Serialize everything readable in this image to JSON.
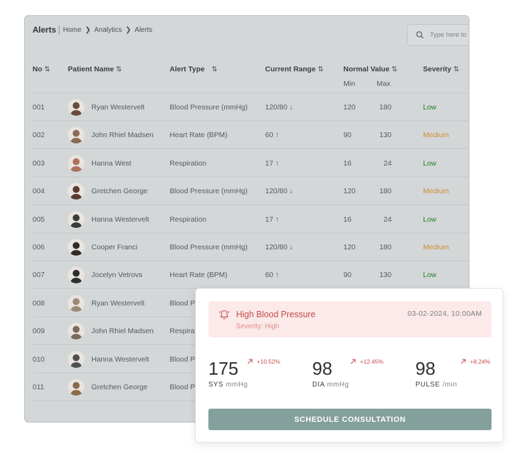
{
  "header": {
    "title": "Alerts",
    "breadcrumb": [
      "Home",
      "Analytics",
      "Alerts"
    ],
    "search_placeholder": "Type here to search"
  },
  "table": {
    "columns": {
      "no": "No",
      "patient": "Patient Name",
      "alert_type": "Alert Type",
      "current_range": "Current Range",
      "normal_value": "Normal Value",
      "normal_min": "Min",
      "normal_max": "Max",
      "severity": "Severity"
    },
    "rows": [
      {
        "no": "001",
        "name": "Ryan Westervelt",
        "type": "Blood Pressure (mmHg)",
        "range": "120/80 ↓",
        "min": "120",
        "max": "180",
        "severity": "Low",
        "sev_level": "low"
      },
      {
        "no": "002",
        "name": "John Rhiel Madsen",
        "type": "Heart Rate (BPM)",
        "range": "60 ↑",
        "min": "90",
        "max": "130",
        "severity": "Medium",
        "sev_level": "medium"
      },
      {
        "no": "003",
        "name": "Hanna West",
        "type": "Respiration",
        "range": "17 ↑",
        "min": "16",
        "max": "24",
        "severity": "Low",
        "sev_level": "low"
      },
      {
        "no": "004",
        "name": "Gretchen George",
        "type": "Blood Pressure (mmHg)",
        "range": "120/80 ↓",
        "min": "120",
        "max": "180",
        "severity": "Medium",
        "sev_level": "medium"
      },
      {
        "no": "005",
        "name": "Hanna Westervelt",
        "type": "Respiration",
        "range": "17 ↑",
        "min": "16",
        "max": "24",
        "severity": "Low",
        "sev_level": "low"
      },
      {
        "no": "006",
        "name": "Cooper Franci",
        "type": "Blood Pressure (mmHg)",
        "range": "120/80 ↓",
        "min": "120",
        "max": "180",
        "severity": "Medium",
        "sev_level": "medium"
      },
      {
        "no": "007",
        "name": "Jocelyn Vetrovs",
        "type": "Heart Rate (BPM)",
        "range": "60 ↑",
        "min": "90",
        "max": "130",
        "severity": "Low",
        "sev_level": "low"
      },
      {
        "no": "008",
        "name": "Ryan Westervelt",
        "type": "Blood P",
        "range": "",
        "min": "",
        "max": "",
        "severity": "",
        "sev_level": "low"
      },
      {
        "no": "009",
        "name": "John Rhiel Madsen",
        "type": "Respira",
        "range": "",
        "min": "",
        "max": "",
        "severity": "",
        "sev_level": "low"
      },
      {
        "no": "010",
        "name": "Hanna Westervelt",
        "type": "Blood P",
        "range": "",
        "min": "",
        "max": "",
        "severity": "",
        "sev_level": "low"
      },
      {
        "no": "011",
        "name": "Gretchen George",
        "type": "Blood P",
        "range": "",
        "min": "",
        "max": "",
        "severity": "",
        "sev_level": "low"
      }
    ]
  },
  "alert_card": {
    "title": "High Blood Pressure",
    "severity": "Severity: High",
    "datetime": "03-02-2024, 10:00AM",
    "metrics": [
      {
        "value": "175",
        "label": "SYS",
        "unit": "mmHg",
        "change": "+10.52%"
      },
      {
        "value": "98",
        "label": "DIA",
        "unit": "mmHg",
        "change": "+12.45%"
      },
      {
        "value": "98",
        "label": "PULSE",
        "unit": "/min",
        "change": "+8.24%"
      }
    ],
    "button": "SCHEDULE CONSULTATION"
  },
  "colors": {
    "panel_bg": "#d3d7d8",
    "low": "#2e7d2e",
    "medium": "#d08a2d",
    "alert_bg": "#fce9e9",
    "alert_text": "#c44a4a",
    "cta": "#84a09c"
  }
}
